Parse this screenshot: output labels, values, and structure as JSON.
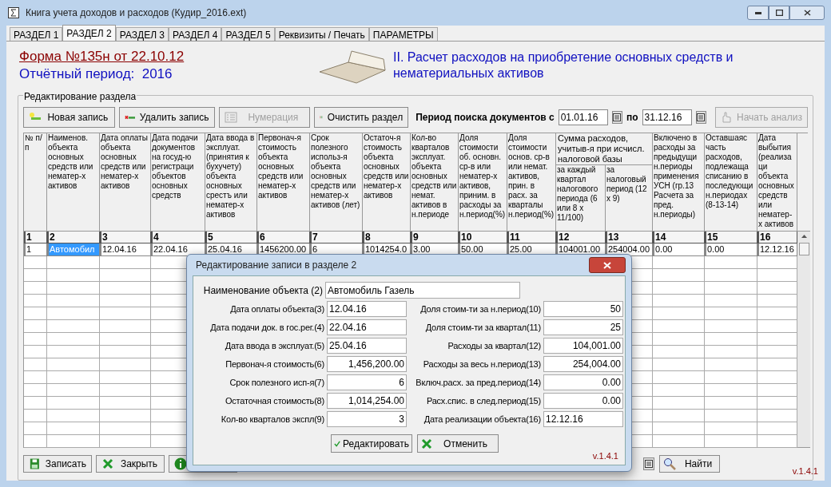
{
  "window": {
    "title": "Книга учета доходов и расходов (Кудир_2016.ext)"
  },
  "tabs": [
    {
      "label": "РАЗДЕЛ 1",
      "selected": false
    },
    {
      "label": "РАЗДЕЛ 2",
      "selected": true
    },
    {
      "label": "РАЗДЕЛ 3",
      "selected": false
    },
    {
      "label": "РАЗДЕЛ 4",
      "selected": false
    },
    {
      "label": "РАЗДЕЛ 5",
      "selected": false
    },
    {
      "label": "Реквизиты / Печать",
      "selected": false
    },
    {
      "label": "ПАРАМЕТРЫ",
      "selected": false
    }
  ],
  "header": {
    "form_title": "Форма №135н от 22.10.12",
    "period": "Отчётный период:  2016",
    "section_title": "II. Расчет расходов на приобретение основных средств и нематериальных активов"
  },
  "edit_group": {
    "label": "Редактирование раздела",
    "buttons": [
      {
        "label": "Новая запись",
        "kind": "new",
        "disabled": false
      },
      {
        "label": "Удалить запись",
        "kind": "delete",
        "disabled": false
      },
      {
        "label": "Нумерация",
        "kind": "numbering",
        "disabled": true
      },
      {
        "label": "Очистить раздел",
        "kind": "clear",
        "disabled": false
      }
    ],
    "search_label": "Период поиска документов с",
    "date_from": "01.01.16",
    "to_label": "по",
    "date_to": "31.12.16",
    "analyze_button": {
      "label": "Начать анализ",
      "disabled": true
    }
  },
  "table": {
    "group_header": "Сумма расходов, учитыв-я при исчисл. налоговой базы",
    "columns": [
      {
        "header": "№ п/п",
        "number": "1"
      },
      {
        "header": "Наименов. объекта основных средств или нематер-х активов",
        "number": "2"
      },
      {
        "header": "Дата оплаты объекта основных средств или нематер-х активов",
        "number": "3"
      },
      {
        "header": "Дата подачи документов на госуд-ю регистраци объектов основных средств",
        "number": "4"
      },
      {
        "header": "Дата ввода в эксплуат. (принятия к бухучету) объекта основных срестъ или нематер-х активов",
        "number": "5"
      },
      {
        "header": "Первонач-я стоимость объекта основных средств или нематер-х активов",
        "number": "6"
      },
      {
        "header": "Срок полезного использ-я объекта основных средств или нематер-х активов (лет)",
        "number": "7"
      },
      {
        "header": "Остаточ-я стоимость объекта основных средств или нематер-х активов",
        "number": "8"
      },
      {
        "header": "Кол-во кварталов эксплуат. объекта основных средств или немат. активов в н.периоде",
        "number": "9"
      },
      {
        "header": "Доля стоимости об. основн. ср-в или нематер-х активов, приним. в расходы за н.период(%)",
        "number": "10"
      },
      {
        "header": "Доля стоимости основ. ср-в или немат. активов, прин. в расх. за кварталы н.период(%)",
        "number": "11"
      },
      {
        "header": "за каждый квартал налогового периода (6 или 8 х 11/100)",
        "number": "12",
        "grouped": true
      },
      {
        "header": "за налоговый период (12 х 9)",
        "number": "13",
        "grouped": true
      },
      {
        "header": "Включено в расходы за предыдущи н.периоды применения УСН (гр.13 Расчета за пред. н.периоды)",
        "number": "14"
      },
      {
        "header": "Оставшаяс часть расходов, подлежаща списанию в последующи н.периодах (8-13-14)",
        "number": "15"
      },
      {
        "header": "Дата выбытия (реализаци объекта основных средств или нематер-х активов",
        "number": "16"
      }
    ],
    "rows": [
      {
        "cells": [
          {
            "text": "1",
            "selected": false
          },
          {
            "text": "Автомобил",
            "selected": true
          },
          {
            "text": "12.04.16",
            "selected": false
          },
          {
            "text": "22.04.16",
            "selected": false
          },
          {
            "text": "25.04.16",
            "selected": false
          },
          {
            "text": "1456200.00",
            "selected": false
          },
          {
            "text": "6",
            "selected": false
          },
          {
            "text": "1014254.0",
            "selected": false
          },
          {
            "text": "3.00",
            "selected": false
          },
          {
            "text": "50.00",
            "selected": false
          },
          {
            "text": "25.00",
            "selected": false
          },
          {
            "text": "104001.00",
            "selected": false
          },
          {
            "text": "254004.00",
            "selected": false
          },
          {
            "text": "0.00",
            "selected": false
          },
          {
            "text": "0.00",
            "selected": false
          },
          {
            "text": "12.12.16",
            "selected": false
          }
        ]
      }
    ]
  },
  "bottom_buttons": [
    {
      "label": "Записать",
      "kind": "save"
    },
    {
      "label": "Закрыть",
      "kind": "close"
    },
    {
      "kind": "info"
    }
  ],
  "find_button": {
    "label": "Найти"
  },
  "version": "v.1.4.1",
  "dialog": {
    "title": "Редактирование записи в разделе 2",
    "name_field": {
      "label": "Наименование объекта (2)",
      "value": "Автомобиль Газель"
    },
    "left_fields": [
      {
        "label": "Дата оплаты объекта(3)",
        "value": "12.04.16",
        "kind": "date"
      },
      {
        "label": "Дата подачи док. в гос.рег.(4)",
        "value": "22.04.16",
        "kind": "date"
      },
      {
        "label": "Дата ввода в эксплуат.(5)",
        "value": "25.04.16",
        "kind": "date"
      },
      {
        "label": "Первонач-я стоимость(6)",
        "value": "1,456,200.00",
        "kind": "number"
      },
      {
        "label": "Срок полезного исп-я(7)",
        "value": "6",
        "kind": "number"
      },
      {
        "label": "Остаточная стоимость(8)",
        "value": "1,014,254.00",
        "kind": "number"
      },
      {
        "label": "Кол-во кварталов экспл(9)",
        "value": "3",
        "kind": "number"
      }
    ],
    "right_fields": [
      {
        "label": "Доля стоим-ти за н.период(10)",
        "value": "50",
        "kind": "number"
      },
      {
        "label": "Доля стоим-ти за квартал(11)",
        "value": "25",
        "kind": "number"
      },
      {
        "label": "Расходы за квартал(12)",
        "value": "104,001.00",
        "kind": "number"
      },
      {
        "label": "Расходы за весь н.период(13)",
        "value": "254,004.00",
        "kind": "number"
      },
      {
        "label": "Включ.расх. за пред.период(14)",
        "value": "0.00",
        "kind": "number"
      },
      {
        "label": "Расх.спис. в след.период(15)",
        "value": "0.00",
        "kind": "number"
      },
      {
        "label": "Дата реализации объекта(16)",
        "value": "12.12.16",
        "kind": "date"
      }
    ],
    "buttons": [
      {
        "label": "Редактировать",
        "kind": "confirm"
      },
      {
        "label": "Отменить",
        "kind": "cancel"
      }
    ],
    "version": "v.1.4.1"
  }
}
